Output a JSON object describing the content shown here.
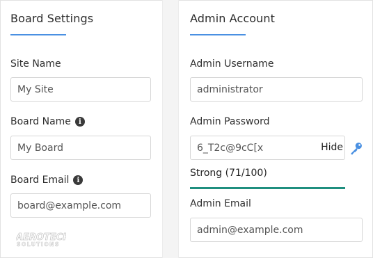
{
  "board_settings": {
    "title": "Board Settings",
    "site_name": {
      "label": "Site Name",
      "value": "My Site"
    },
    "board_name": {
      "label": "Board Name",
      "value": "My Board"
    },
    "board_email": {
      "label": "Board Email",
      "value": "board@example.com"
    }
  },
  "admin_account": {
    "title": "Admin Account",
    "username": {
      "label": "Admin Username",
      "value": "administrator"
    },
    "password": {
      "label": "Admin Password",
      "value": "6_T2c@9cC[x",
      "toggle_label": "Hide",
      "strength_text": "Strong (71/100)",
      "strength_score": 71
    },
    "email": {
      "label": "Admin Email",
      "value": "admin@example.com"
    }
  },
  "logo": {
    "line1": "AEROTECH",
    "line2": "SOLUTIONS"
  },
  "colors": {
    "accent": "#4a90e2",
    "strength_bar": "#1f8f7f",
    "key_icon": "#4a90e2"
  },
  "icons": [
    "info-icon",
    "key-icon"
  ]
}
